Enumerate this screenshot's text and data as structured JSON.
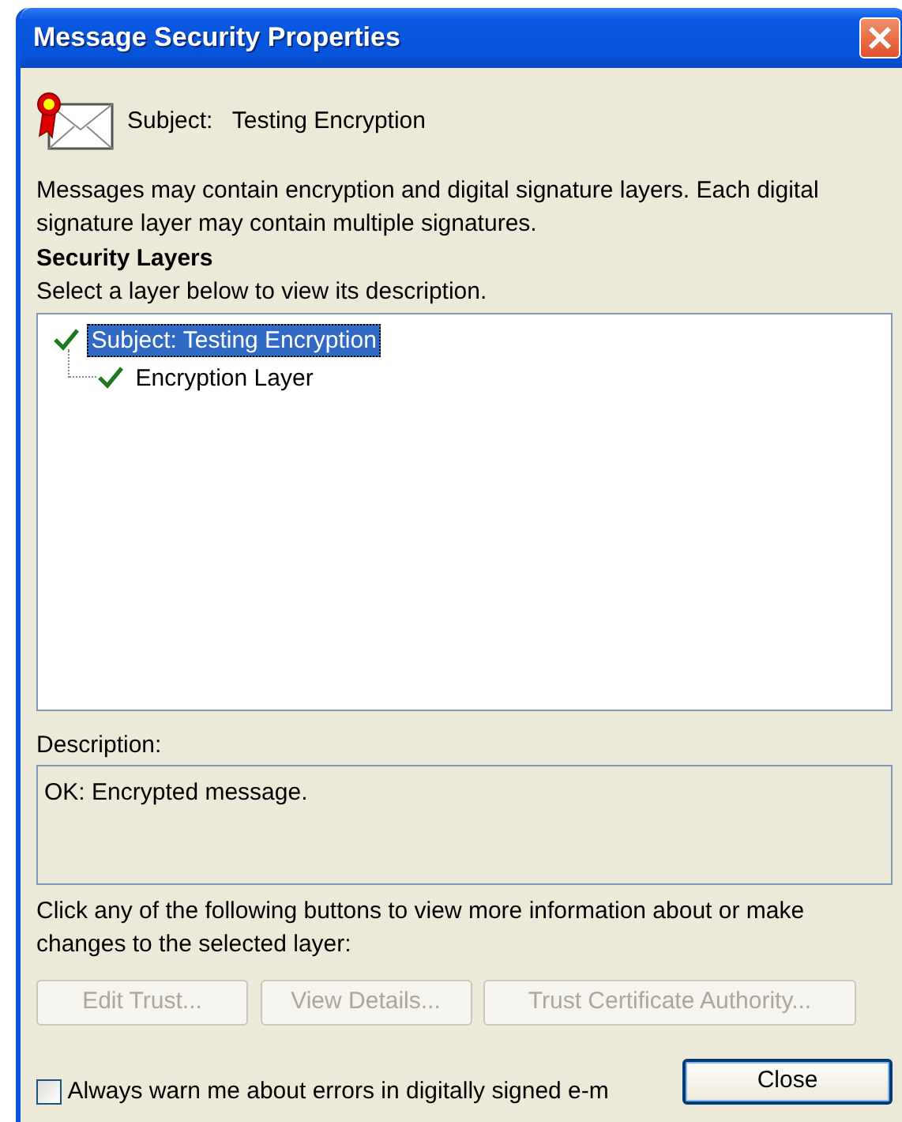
{
  "window": {
    "title": "Message Security Properties"
  },
  "subject": {
    "label": "Subject:",
    "value": "Testing Encryption"
  },
  "intro": "Messages may contain encryption and digital signature layers.  Each digital signature layer may contain multiple signatures.",
  "layers_heading": "Security Layers",
  "layers_hint": "Select a layer below to view its description.",
  "layers": [
    {
      "label": "Subject: Testing Encryption",
      "valid": true,
      "selected": true,
      "children": [
        {
          "label": "Encryption Layer",
          "valid": true,
          "selected": false
        }
      ]
    }
  ],
  "description": {
    "label": "Description:",
    "text": "OK: Encrypted message."
  },
  "actions_hint": "Click any of the following buttons to view more information about or make changes to the selected layer:",
  "action_buttons": [
    {
      "label": "Edit Trust...",
      "disabled": true
    },
    {
      "label": "View Details...",
      "disabled": true
    },
    {
      "label": "Trust Certificate Authority...",
      "disabled": true
    }
  ],
  "always_warn": {
    "label": "Always warn me about errors in digitally signed e-m",
    "checked": false
  },
  "close_button": {
    "label": "Close",
    "disabled": false
  }
}
